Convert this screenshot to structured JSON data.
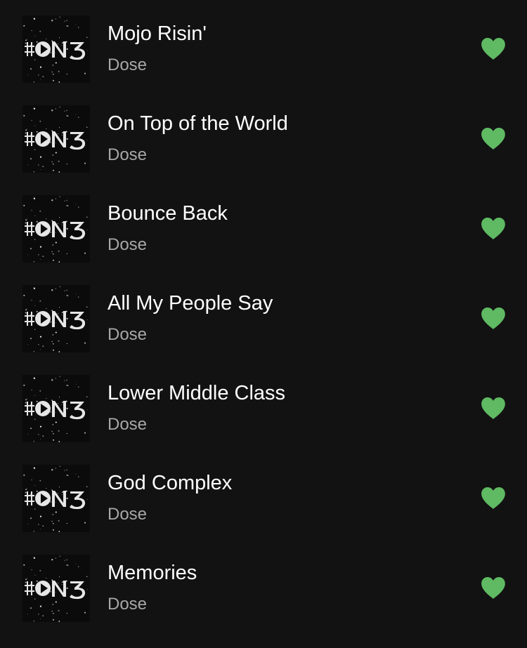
{
  "accent_color": "#5fba63",
  "tracks": [
    {
      "title": "Mojo Risin'",
      "artist": "Dose",
      "liked": true,
      "cover_icon": "album-cover-hon3"
    },
    {
      "title": "On Top of the World",
      "artist": "Dose",
      "liked": true,
      "cover_icon": "album-cover-hon3"
    },
    {
      "title": "Bounce Back",
      "artist": "Dose",
      "liked": true,
      "cover_icon": "album-cover-hon3"
    },
    {
      "title": "All My People Say",
      "artist": "Dose",
      "liked": true,
      "cover_icon": "album-cover-hon3"
    },
    {
      "title": "Lower Middle Class",
      "artist": "Dose",
      "liked": true,
      "cover_icon": "album-cover-hon3"
    },
    {
      "title": "God Complex",
      "artist": "Dose",
      "liked": true,
      "cover_icon": "album-cover-hon3"
    },
    {
      "title": "Memories",
      "artist": "Dose",
      "liked": true,
      "cover_icon": "album-cover-hon3"
    }
  ]
}
